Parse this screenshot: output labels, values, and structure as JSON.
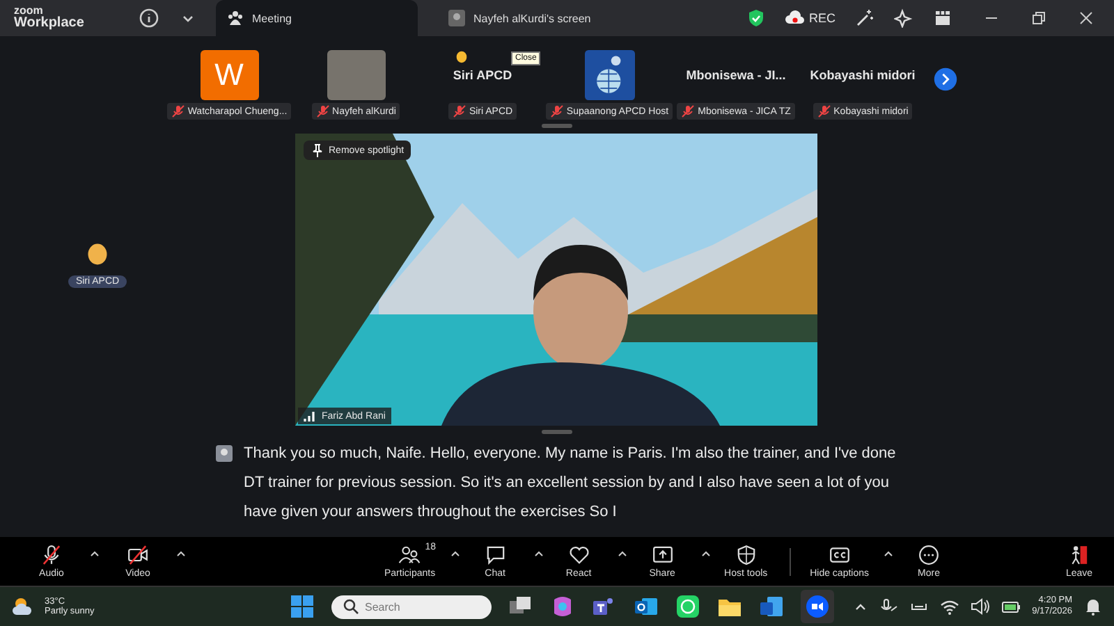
{
  "title_bar": {
    "logo_top": "zoom",
    "logo_bottom": "Workplace",
    "tabs": [
      {
        "label": "Meeting",
        "selected": true
      },
      {
        "label": "Nayfeh  alKurdi's screen",
        "selected": false
      }
    ],
    "rec": "REC"
  },
  "strip": {
    "tiles": [
      {
        "kind": "initial",
        "initial": "W",
        "name": "Watcharapol Chueng...",
        "muted": true
      },
      {
        "kind": "photo",
        "name": "Nayfeh  alKurdi",
        "muted": true
      },
      {
        "kind": "name",
        "display": "Siri APCD",
        "name": "Siri APCD",
        "muted": true,
        "reaction": true
      },
      {
        "kind": "logo",
        "name": "Supaanong APCD Host",
        "muted": true
      },
      {
        "kind": "name",
        "display": "Mbonisewa - JI...",
        "name": "Mbonisewa - JICA TZ",
        "muted": true,
        "reaction": false
      },
      {
        "kind": "name",
        "display": "Kobayashi midori",
        "name": "Kobayashi midori",
        "muted": true,
        "reaction": false
      }
    ],
    "tooltip": "Close"
  },
  "side_tile": {
    "name": "Siri APCD"
  },
  "spotlight": {
    "button": "Remove spotlight",
    "speaker": "Fariz Abd Rani"
  },
  "caption": "Thank you so much, Naife. Hello, everyone. My name is Paris. I'm also the trainer, and I've done DT trainer for previous session. So it's an excellent session by and I also have seen a lot of you have given your answers throughout the exercises So I",
  "toolbar": [
    {
      "kind": "audio",
      "label": "Audio",
      "off": true,
      "menu": true
    },
    {
      "kind": "video",
      "label": "Video",
      "off": true,
      "menu": true
    },
    {
      "kind": "participants",
      "label": "Participants",
      "count": "18",
      "menu": true
    },
    {
      "kind": "chat",
      "label": "Chat",
      "menu": true
    },
    {
      "kind": "react",
      "label": "React",
      "menu": true
    },
    {
      "kind": "share",
      "label": "Share",
      "menu": true
    },
    {
      "kind": "host",
      "label": "Host tools",
      "menu": false
    },
    {
      "kind": "cc",
      "label": "Hide captions",
      "menu": true
    },
    {
      "kind": "more",
      "label": "More",
      "menu": false
    },
    {
      "kind": "leave",
      "label": "Leave",
      "menu": false
    }
  ],
  "taskbar": {
    "temperature": "33°C",
    "weather": "Partly sunny",
    "search_placeholder": "Search",
    "time": "4:20 PM",
    "date": "9/17/2026"
  }
}
